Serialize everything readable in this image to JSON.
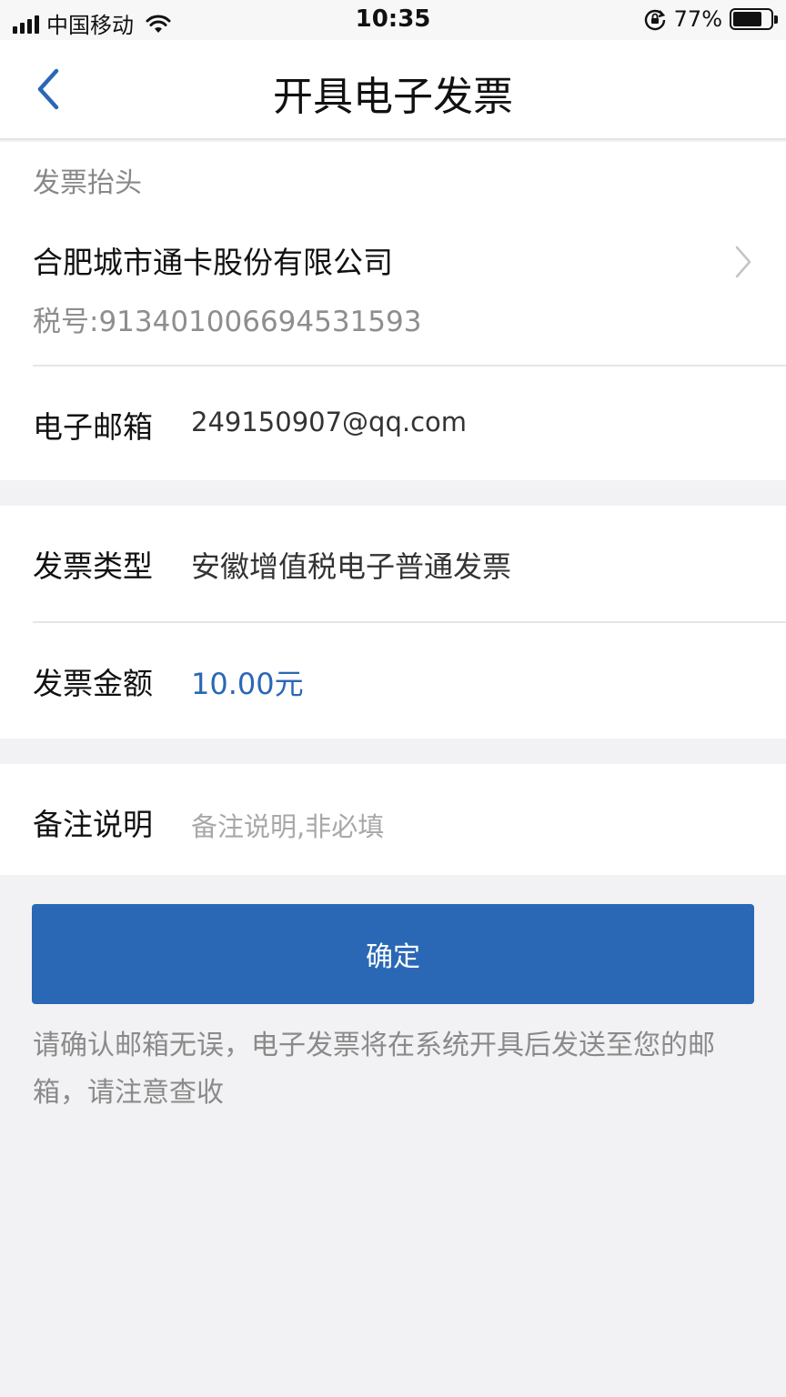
{
  "status_bar": {
    "carrier": "中国移动",
    "time": "10:35",
    "battery_percent_text": "77%",
    "battery_level": 0.77,
    "icons": [
      "signal-icon",
      "wifi-icon",
      "rotation-lock-icon",
      "battery-icon"
    ]
  },
  "nav": {
    "title": "开具电子发票",
    "back_icon": "chevron-left-icon"
  },
  "invoice_header": {
    "section_label": "发票抬头",
    "company_name": "合肥城市通卡股份有限公司",
    "tax_id": "税号:913401006694531593"
  },
  "email": {
    "label": "电子邮箱",
    "value": "249150907@qq.com"
  },
  "invoice_type": {
    "label": "发票类型",
    "value": "安徽增值税电子普通发票"
  },
  "invoice_amount": {
    "label": "发票金额",
    "value": "10.00元"
  },
  "remark": {
    "label": "备注说明",
    "placeholder": "备注说明,非必填"
  },
  "confirm_button": {
    "label": "确定"
  },
  "notice": "请确认邮箱无误，电子发票将在系统开具后发送至您的邮箱，请注意查收",
  "colors": {
    "accent": "#2a68b5",
    "background": "#f2f2f4",
    "muted_text": "#888888"
  }
}
